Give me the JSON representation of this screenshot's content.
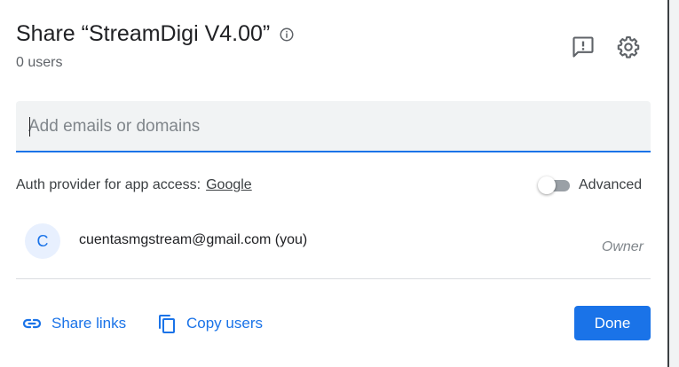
{
  "dialog": {
    "title": "Share “StreamDigi V4.00”",
    "subtitle": "0 users",
    "icons": {
      "info": "info-icon",
      "feedback": "feedback-icon",
      "settings": "gear-icon"
    }
  },
  "email_input": {
    "value": "",
    "placeholder": "Add emails or domains"
  },
  "auth": {
    "label": "Auth provider for app access:",
    "provider": "Google"
  },
  "advanced": {
    "label": "Advanced",
    "enabled": false
  },
  "users": [
    {
      "avatar_letter": "C",
      "email": "cuentasmgstream@gmail.com (you)",
      "role": "Owner"
    }
  ],
  "footer": {
    "share_links_label": "Share links",
    "copy_users_label": "Copy users",
    "done_label": "Done"
  },
  "colors": {
    "accent": "#1a73e8",
    "avatar_bg": "#e8f0fe",
    "input_bg": "#f1f3f4",
    "toggle_off": "#9aa0a6"
  }
}
